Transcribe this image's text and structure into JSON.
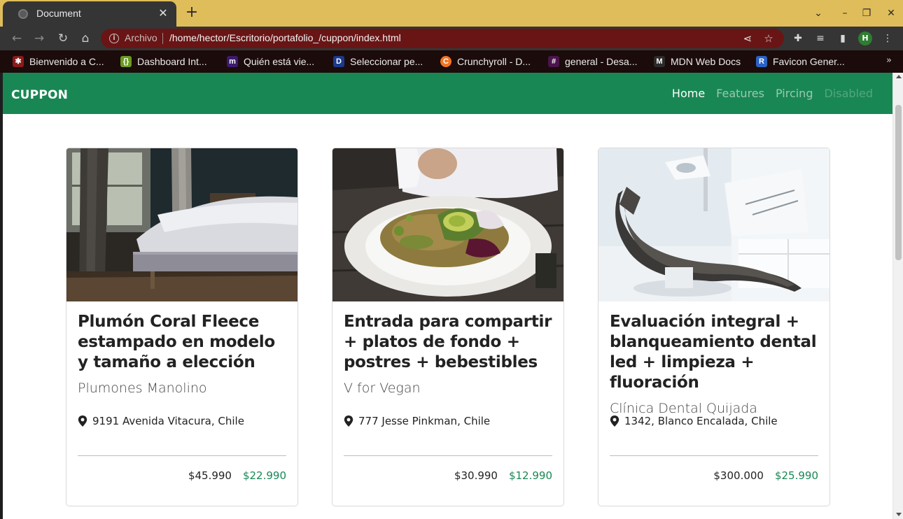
{
  "browser": {
    "tab_title": "Document",
    "new_tab": "+",
    "omnibox_scheme": "Archivo",
    "url": "/home/hector/Escritorio/portafolio_/cuppon/index.html",
    "profile_initial": "H",
    "bookmarks": [
      {
        "label": "Bienvenido a C...",
        "icon": "red-bookmark-icon",
        "color": "#8b1a1a"
      },
      {
        "label": "Dashboard Int...",
        "icon": "green-bookmark-icon",
        "color": "#6a9a1f"
      },
      {
        "label": "Quién está vie...",
        "icon": "m-bookmark-icon",
        "color": "#3d1a6e"
      },
      {
        "label": "Seleccionar pe...",
        "icon": "disney-bookmark-icon",
        "color": "#1a3a8b"
      },
      {
        "label": "Crunchyroll - D...",
        "icon": "crunchyroll-icon",
        "color": "#f47521"
      },
      {
        "label": "general - Desa...",
        "icon": "slack-icon",
        "color": "#4a154b"
      },
      {
        "label": "MDN Web Docs",
        "icon": "mdn-icon",
        "color": "#2b2b2b"
      },
      {
        "label": "Favicon Gener...",
        "icon": "realfavicon-icon",
        "color": "#2a62c4"
      }
    ],
    "bookmarks_more": "»"
  },
  "navbar": {
    "brand": "CUPPON",
    "links": [
      {
        "label": "Home",
        "state": "active"
      },
      {
        "label": "Features",
        "state": "normal"
      },
      {
        "label": "Pircing",
        "state": "normal"
      },
      {
        "label": "Disabled",
        "state": "disabled"
      }
    ]
  },
  "cards": [
    {
      "image": "bedroom-photo",
      "title": "Plumón Coral Fleece estampado en modelo y tamaño a elección",
      "subtitle": "Plumones Manolino",
      "location": "9191 Avenida Vitacura, Chile",
      "price_old": "$45.990",
      "price_new": "$22.990"
    },
    {
      "image": "salad-photo",
      "title": "Entrada para compartir + platos de fondo + postres + bebestibles",
      "subtitle": "V for Vegan",
      "location": "777 Jesse Pinkman, Chile",
      "price_old": "$30.990",
      "price_new": "$12.990"
    },
    {
      "image": "dental-chair-photo",
      "title": "Evaluación integral + blanqueamiento dental led + limpieza + fluoración",
      "subtitle": "Clínica Dental Quijada",
      "location": "1342, Blanco Encalada, Chile",
      "price_old": "$300.000",
      "price_new": "$25.990"
    }
  ],
  "colors": {
    "navbar_green": "#198754",
    "price_green": "#198754",
    "tab_strip": "#dfbd5a",
    "omnibox": "#691515"
  }
}
